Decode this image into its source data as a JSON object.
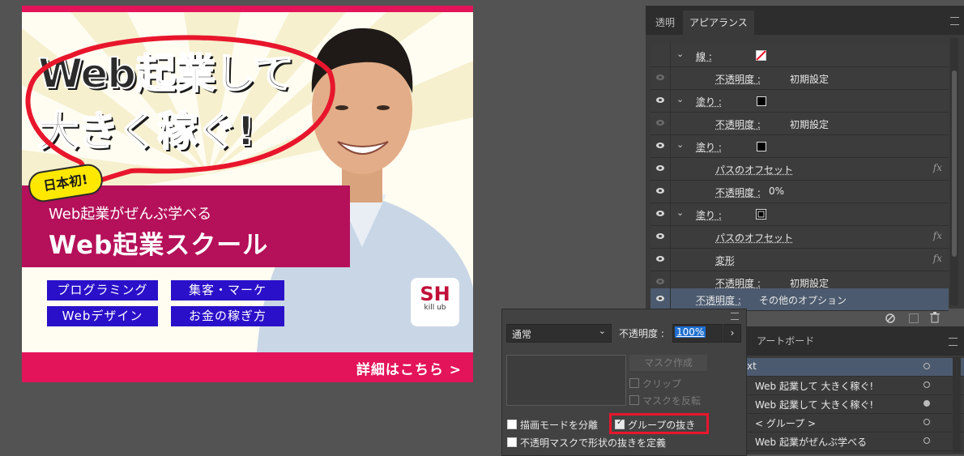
{
  "banner": {
    "headline_line1": "Web起業して",
    "headline_line2": "大きく稼ぐ!",
    "badge": "日本初!",
    "subheading": "Web起業がぜんぶ学べる",
    "title": "Web起業スクール",
    "tags": [
      "プログラミング",
      "集客・マーケ",
      "Webデザイン",
      "お金の稼ぎ方"
    ],
    "cta": "詳細はこちら >",
    "logo_main": "SH",
    "logo_sub": "kill ub"
  },
  "appearance_panel": {
    "tabs": [
      "透明",
      "アピアランス"
    ],
    "rows": [
      {
        "label": "線 :",
        "indent": 0,
        "expand": true,
        "swatch": "stroke-none",
        "eye": "none"
      },
      {
        "label": "不透明度 :",
        "value": "初期設定",
        "indent": 1,
        "eye": "dim"
      },
      {
        "label": "塗り :",
        "indent": 0,
        "expand": true,
        "swatch": "black",
        "eye": "on"
      },
      {
        "label": "不透明度 :",
        "value": "初期設定",
        "indent": 1,
        "eye": "dim"
      },
      {
        "label": "塗り :",
        "indent": 0,
        "expand": true,
        "swatch": "black",
        "eye": "on"
      },
      {
        "label": "パスのオフセット",
        "indent": 1,
        "fx": "fx",
        "eye": "on"
      },
      {
        "label": "不透明度 :",
        "value": "0%",
        "indent": 1,
        "eye": "on"
      },
      {
        "label": "塗り :",
        "indent": 0,
        "expand": true,
        "swatch": "black-outline",
        "eye": "on"
      },
      {
        "label": "パスのオフセット",
        "indent": 1,
        "fx": "fx",
        "eye": "on"
      },
      {
        "label": "変形",
        "indent": 1,
        "fx": "fx",
        "eye": "on"
      },
      {
        "label": "不透明度 :",
        "value": "初期設定",
        "indent": 1,
        "eye": "dim"
      },
      {
        "label": "不透明度 :",
        "value": "その他のオプション",
        "indent": 0,
        "eye": "on",
        "selected": true
      }
    ]
  },
  "layers_panel": {
    "tab": "アートボード",
    "rows": [
      "xt",
      "Web 起業して 大きく稼ぐ!",
      "Web 起業して 大きく稼ぐ!",
      "< グループ >",
      "Web 起業がぜんぶ学べる"
    ]
  },
  "transparency_popup": {
    "blend_mode": "通常",
    "opacity_label": "不透明度 :",
    "opacity_value": "100%",
    "mask_button": "マスク作成",
    "clip": "クリップ",
    "invert_mask": "マスクを反転",
    "isolate_blending": "描画モードを分離",
    "knockout_group": "グループの抜き",
    "opacity_mask_knockout": "不透明マスクで形状の抜きを定義"
  },
  "colors": {
    "accent_pink": "#e3145a",
    "band_magenta": "#b5105a",
    "tag_blue": "#2a10c9",
    "highlight_red": "#e8162c",
    "panel_bg": "#3a3a3a"
  }
}
